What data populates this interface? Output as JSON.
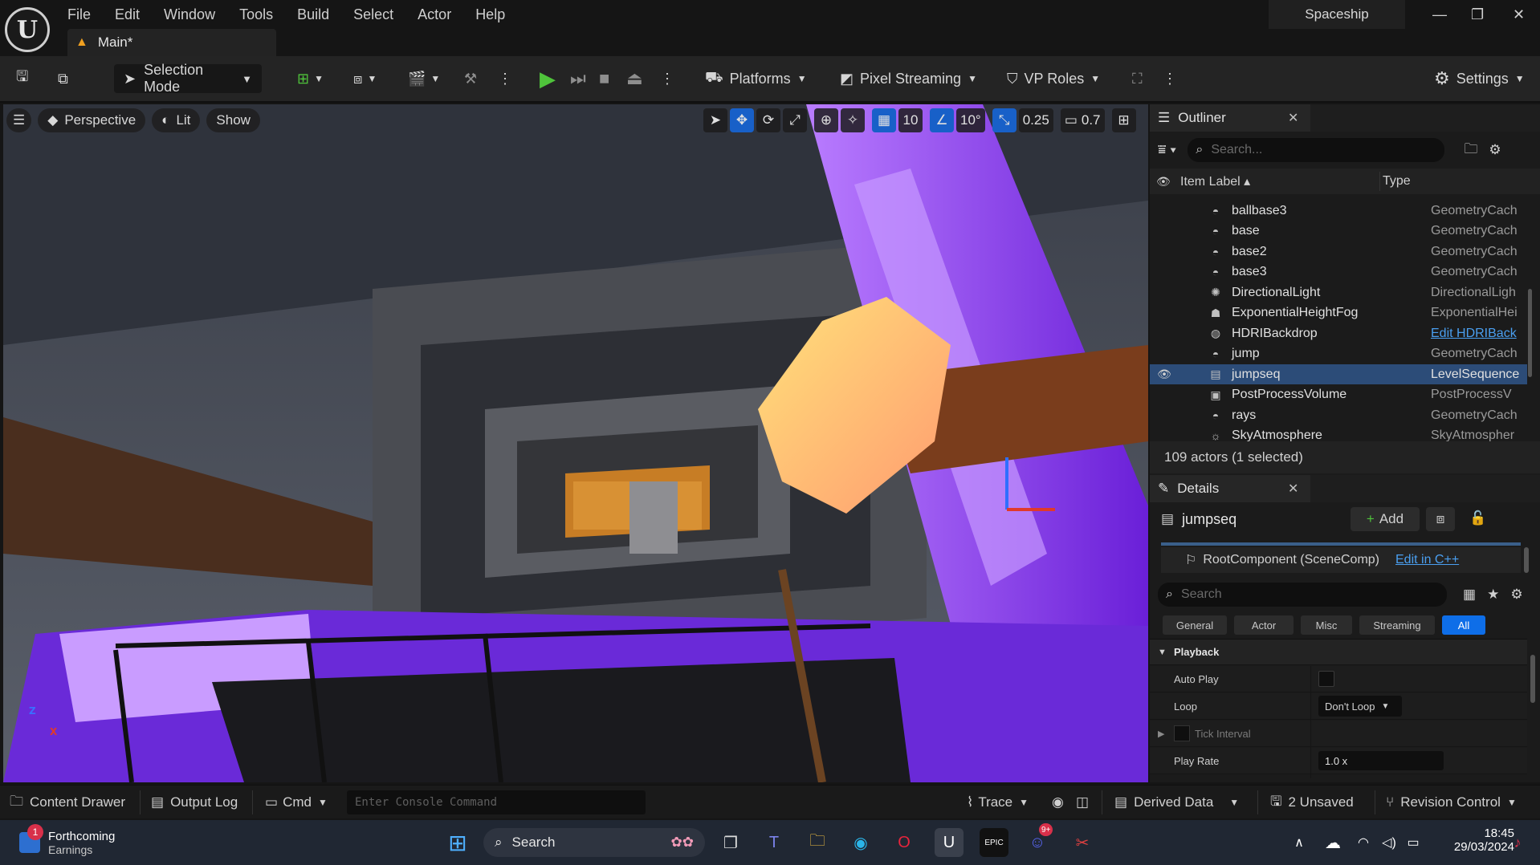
{
  "app": {
    "logo": "U",
    "menu": [
      "File",
      "Edit",
      "Window",
      "Tools",
      "Build",
      "Select",
      "Actor",
      "Help"
    ],
    "tab_label": "Main*",
    "project_name": "Spaceship"
  },
  "toolbar": {
    "selection_mode": "Selection Mode",
    "platforms": "Platforms",
    "pixel_streaming": "Pixel Streaming",
    "vp_roles": "VP Roles",
    "settings": "Settings"
  },
  "viewport": {
    "perspective": "Perspective",
    "lit": "Lit",
    "show": "Show",
    "grid_snap": "10",
    "rot_snap": "10°",
    "scale_snap": "0.25",
    "cam_speed": "0.7"
  },
  "outliner": {
    "title": "Outliner",
    "search_placeholder": "Search...",
    "col_label": "Item Label",
    "col_type": "Type",
    "rows": [
      {
        "label": "ballbase3",
        "type": "GeometryCach",
        "icon": "geometry-cache-icon"
      },
      {
        "label": "base",
        "type": "GeometryCach",
        "icon": "geometry-cache-icon"
      },
      {
        "label": "base2",
        "type": "GeometryCach",
        "icon": "geometry-cache-icon"
      },
      {
        "label": "base3",
        "type": "GeometryCach",
        "icon": "geometry-cache-icon"
      },
      {
        "label": "DirectionalLight",
        "type": "DirectionalLigh",
        "icon": "directional-light-icon"
      },
      {
        "label": "ExponentialHeightFog",
        "type": "ExponentialHei",
        "icon": "fog-icon"
      },
      {
        "label": "HDRIBackdrop",
        "type": "Edit HDRIBack",
        "icon": "backdrop-icon"
      },
      {
        "label": "jump",
        "type": "GeometryCach",
        "icon": "geometry-cache-icon"
      },
      {
        "label": "jumpseq",
        "type": "LevelSequence",
        "icon": "level-sequence-icon"
      },
      {
        "label": "PostProcessVolume",
        "type": "PostProcessV",
        "icon": "post-process-icon"
      },
      {
        "label": "rays",
        "type": "GeometryCach",
        "icon": "geometry-cache-icon"
      },
      {
        "label": "SkyAtmosphere",
        "type": "SkyAtmospher",
        "icon": "sky-icon"
      }
    ],
    "footer": "109 actors (1 selected)"
  },
  "details": {
    "title": "Details",
    "actor_name": "jumpseq",
    "add_label": "Add",
    "root_component": "RootComponent (SceneComp)",
    "edit_cpp": "Edit in C++",
    "search_placeholder": "Search",
    "filters": [
      "General",
      "Actor",
      "Misc",
      "Streaming",
      "All"
    ],
    "section": "Playback",
    "props": {
      "auto_play": "Auto Play",
      "loop": "Loop",
      "loop_value": "Don't Loop",
      "tick_interval": "Tick Interval",
      "play_rate": "Play Rate",
      "play_rate_value": "1.0 x"
    }
  },
  "bottombar": {
    "content_drawer": "Content Drawer",
    "output_log": "Output Log",
    "cmd": "Cmd",
    "console_placeholder": "Enter Console Command",
    "trace": "Trace",
    "derived_data": "Derived Data",
    "unsaved": "2 Unsaved",
    "revision_control": "Revision Control"
  },
  "taskbar": {
    "widget_title": "Forthcoming",
    "widget_sub": "Earnings",
    "widget_badge": "1",
    "search": "Search",
    "time": "18:45",
    "date": "29/03/2024",
    "discord_badge": "9+"
  },
  "colors": {
    "accent_blue": "#0e6ee8",
    "play_green": "#4fc33b",
    "selected_row": "#2c4c78",
    "taskbar": "#202733"
  }
}
